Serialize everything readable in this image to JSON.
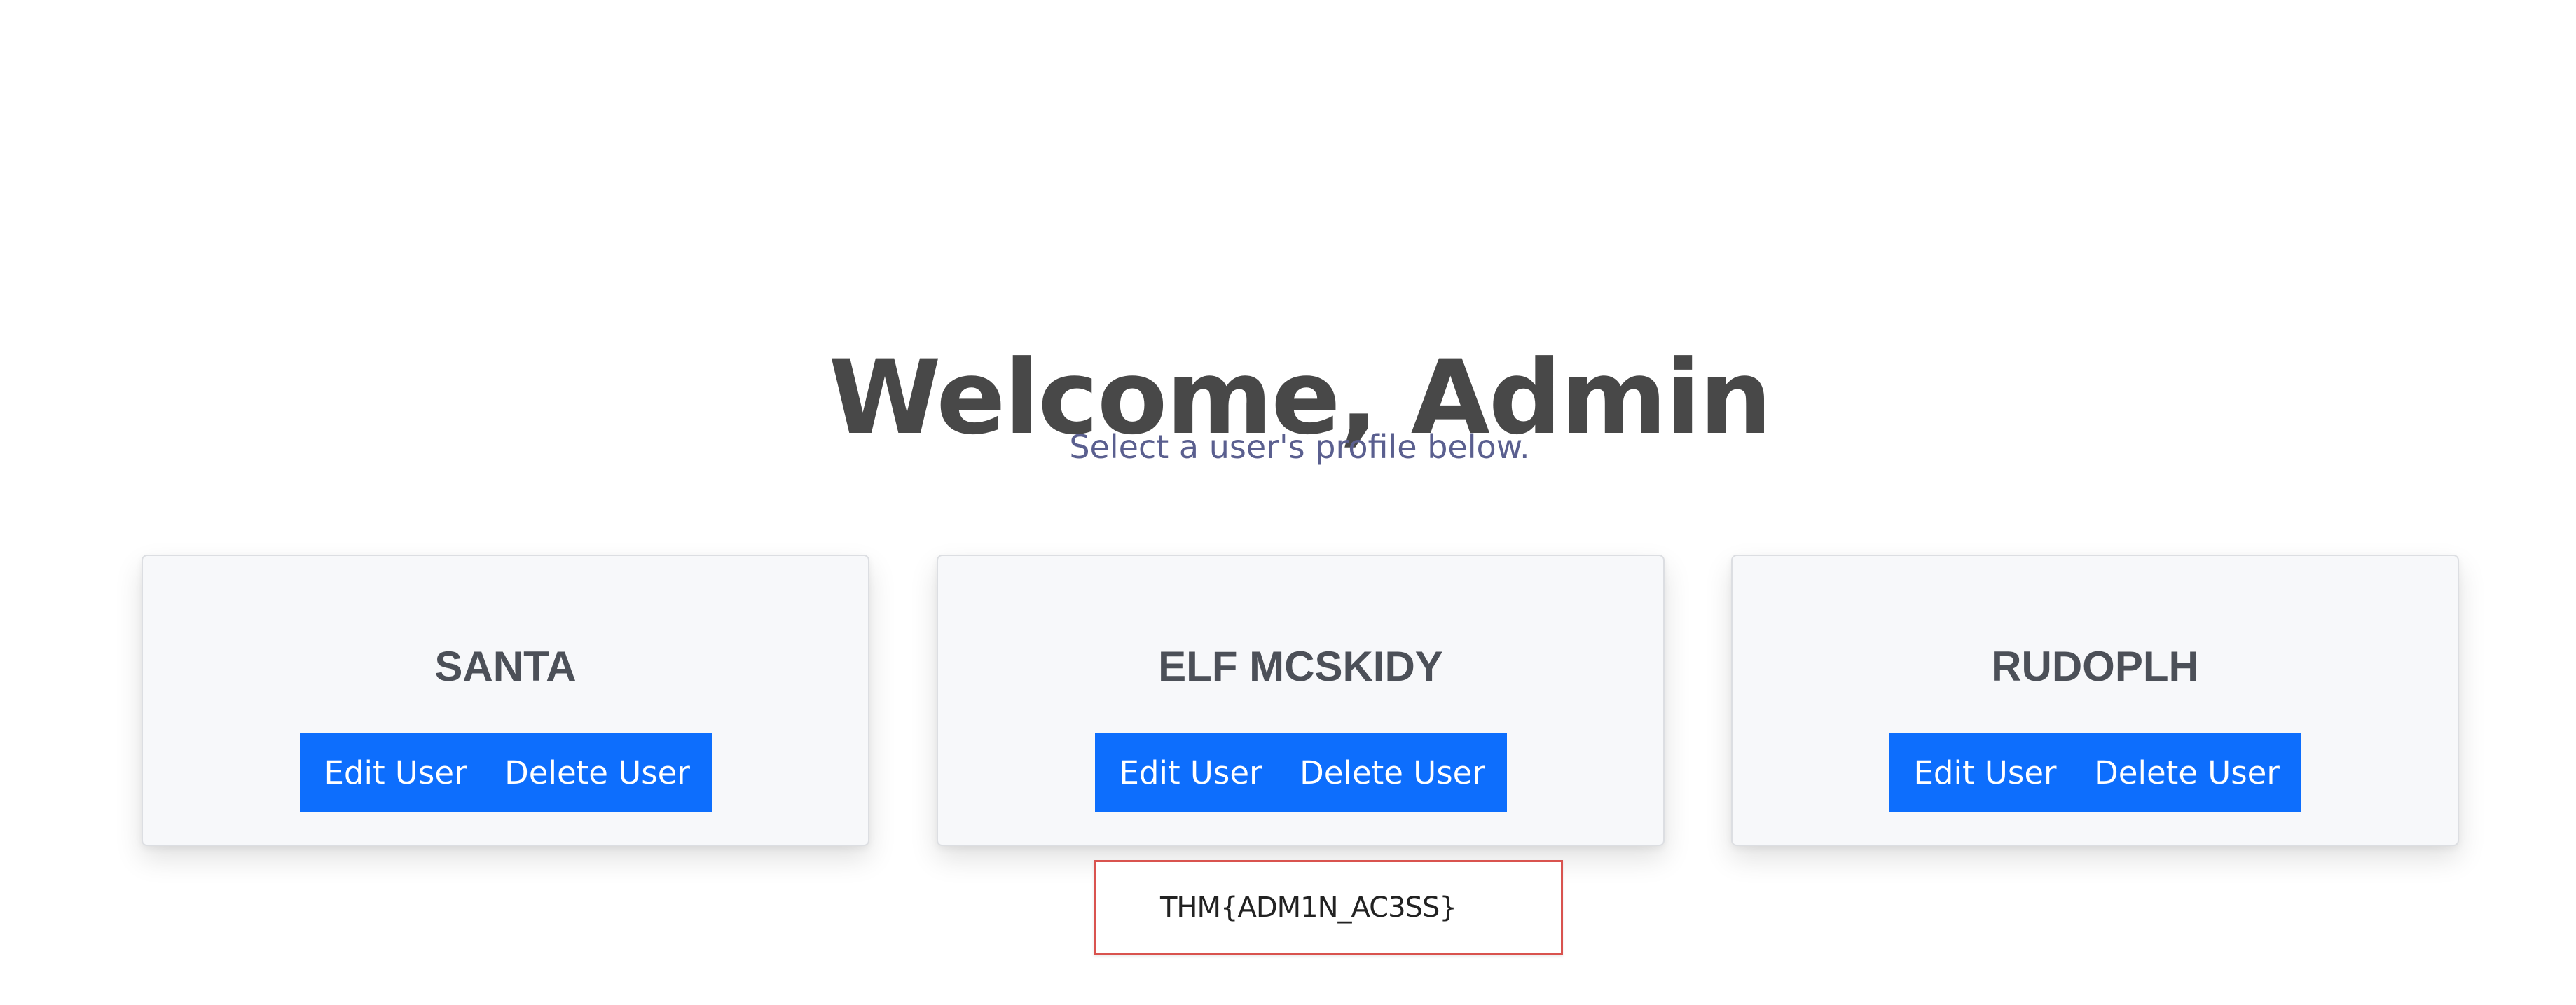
{
  "header": {
    "title": "Welcome, Admin",
    "subtitle": "Select a user's profile below."
  },
  "users": [
    {
      "name": "SANTA",
      "edit_label": "Edit User",
      "delete_label": "Delete User"
    },
    {
      "name": "ELF MCSKIDY",
      "edit_label": "Edit User",
      "delete_label": "Delete User"
    },
    {
      "name": "RUDOPLH",
      "edit_label": "Edit User",
      "delete_label": "Delete User"
    }
  ],
  "flag": {
    "text": "THM{ADM1N_AC3SS}"
  },
  "colors": {
    "accent": "#0d6efd",
    "title": "#484848",
    "subtitle": "#5a5f8f",
    "card_background": "#f7f8fa",
    "flag_border": "#d9534f"
  }
}
